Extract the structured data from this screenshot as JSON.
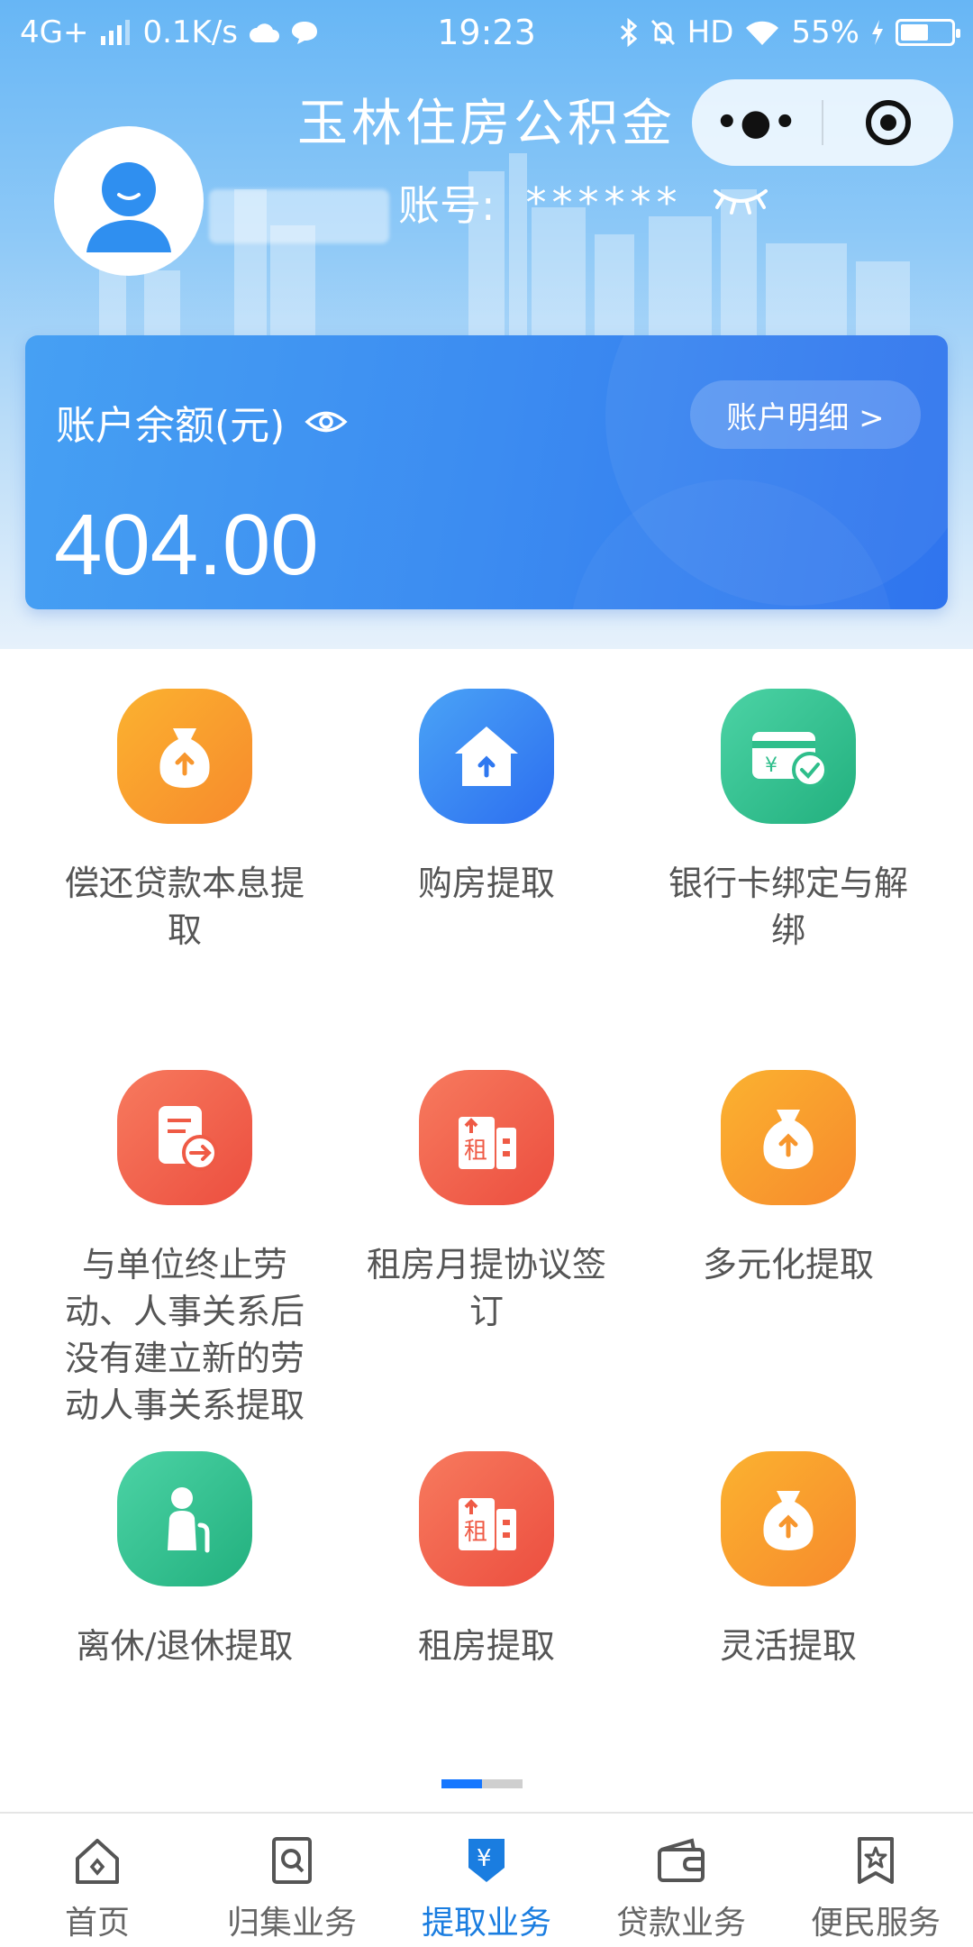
{
  "status_bar": {
    "network": "4G+",
    "speed": "0.1K/s",
    "time": "19:23",
    "hd": "HD",
    "battery": "55%",
    "battery_level": 0.55
  },
  "header": {
    "title": "玉林住房公积金",
    "account_label": "账号:",
    "account_value": "******"
  },
  "balance_card": {
    "label": "账户余额(元)",
    "value": "404.00",
    "detail_button": "账户明细 >"
  },
  "services": [
    {
      "label": "偿还贷款本息提取",
      "icon": "money-bag-icon",
      "color": "orange"
    },
    {
      "label": "购房提取",
      "icon": "house-icon",
      "color": "blue"
    },
    {
      "label": "银行卡绑定与解绑",
      "icon": "bank-card-icon",
      "color": "green"
    },
    {
      "label": "与单位终止劳动、人事关系后没有建立新的劳动人事关系提取",
      "icon": "document-arrow-icon",
      "color": "red"
    },
    {
      "label": "租房月提协议签订",
      "icon": "rent-building-icon",
      "color": "red"
    },
    {
      "label": "多元化提取",
      "icon": "money-bag-icon",
      "color": "orange"
    },
    {
      "label": "离休/退休提取",
      "icon": "elderly-person-icon",
      "color": "green"
    },
    {
      "label": "租房提取",
      "icon": "rent-building-icon",
      "color": "red"
    },
    {
      "label": "灵活提取",
      "icon": "money-bag-icon",
      "color": "orange"
    }
  ],
  "rent_char": "租",
  "yuan_char": "¥",
  "tabs": [
    {
      "label": "首页",
      "icon": "home-icon"
    },
    {
      "label": "归集业务",
      "icon": "search-doc-icon"
    },
    {
      "label": "提取业务",
      "icon": "withdraw-icon",
      "active": true
    },
    {
      "label": "贷款业务",
      "icon": "wallet-icon"
    },
    {
      "label": "便民服务",
      "icon": "star-bookmark-icon"
    }
  ],
  "colors": {
    "accent": "#1a7de0",
    "card": "#3c8cf1",
    "orange": "#f99a2d",
    "blue": "#3a87f3",
    "green": "#2fbe8b",
    "red": "#ef5a45"
  }
}
